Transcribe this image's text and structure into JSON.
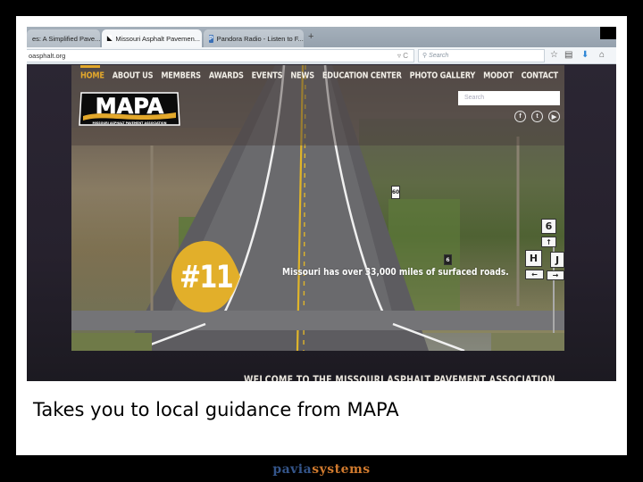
{
  "browser": {
    "tabs": [
      {
        "label": "es: A Simplified Pave...",
        "favicon": "page-icon",
        "active": false
      },
      {
        "label": "Missouri Asphalt Pavemen...",
        "favicon": "mapa-favicon",
        "active": true
      },
      {
        "label": "Pandora Radio - Listen to F...",
        "favicon": "pandora-favicon",
        "favicon_glyph": "P",
        "active": false
      }
    ],
    "tab_close_glyph": "×",
    "new_tab_glyph": "+",
    "url": "oasphalt.org",
    "url_actions": "▿ C",
    "search_placeholder": "Search",
    "toolbar_icons": [
      "bookmark-star-icon",
      "reading-list-icon",
      "download-icon",
      "home-icon"
    ]
  },
  "site": {
    "nav": [
      {
        "label": "HOME",
        "active": true
      },
      {
        "label": "ABOUT US",
        "active": false
      },
      {
        "label": "MEMBERS",
        "active": false
      },
      {
        "label": "AWARDS",
        "active": false
      },
      {
        "label": "EVENTS",
        "active": false
      },
      {
        "label": "NEWS",
        "active": false
      },
      {
        "label": "EDUCATION CENTER",
        "active": false
      },
      {
        "label": "PHOTO GALLERY",
        "active": false
      },
      {
        "label": "MODOT",
        "active": false
      },
      {
        "label": "CONTACT",
        "active": false
      }
    ],
    "logo": {
      "text": "MAPA",
      "tagline": "MISSOURI ASPHALT PAVEMENT ASSOCIATION"
    },
    "search_placeholder": "Search",
    "social": [
      {
        "name": "facebook",
        "glyph": "f"
      },
      {
        "name": "twitter",
        "glyph": "t"
      },
      {
        "name": "youtube",
        "glyph": "▶"
      }
    ],
    "hero": {
      "badge": "#11",
      "fact": "Missouri has over 33,000 miles of surfaced roads.",
      "signs": {
        "route": "6",
        "speed": "60",
        "left": "H",
        "right": "J"
      }
    },
    "welcome": "WELCOME TO THE MISSOURI ASPHALT PAVEMENT ASSOCIATION"
  },
  "slide": {
    "caption": "Takes you to local guidance from MAPA",
    "brand_part1": "pavia",
    "brand_part2": "systems"
  },
  "colors": {
    "accent_gold": "#e3a82b",
    "brand_blue": "#34558a",
    "brand_orange": "#d07a2e"
  }
}
